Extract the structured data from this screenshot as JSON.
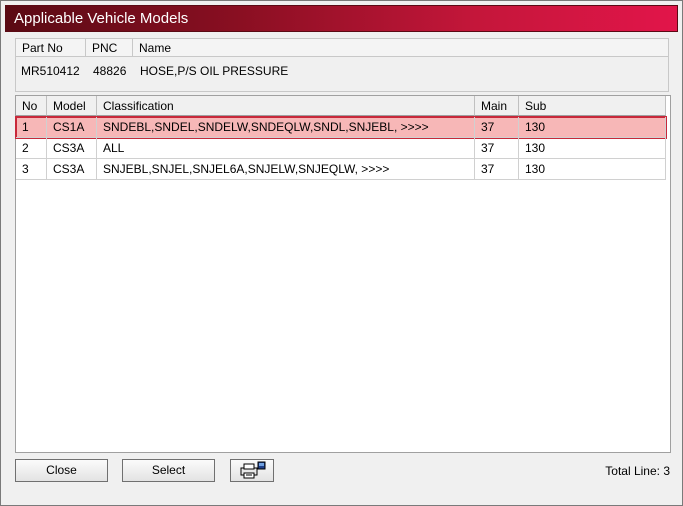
{
  "window": {
    "title": "Applicable Vehicle Models"
  },
  "part_info": {
    "headers": [
      "Part No",
      "PNC",
      "Name"
    ],
    "values": [
      "MR510412",
      "48826",
      "HOSE,P/S OIL PRESSURE"
    ]
  },
  "grid": {
    "columns": [
      "No",
      "Model",
      "Classification",
      "Main",
      "Sub"
    ],
    "rows": [
      {
        "no": "1",
        "model": "CS1A",
        "classification": "SNDEBL,SNDEL,SNDELW,SNDEQLW,SNDL,SNJEBL,  >>>>",
        "main": "37",
        "sub": "130",
        "selected": true
      },
      {
        "no": "2",
        "model": "CS3A",
        "classification": "ALL",
        "main": "37",
        "sub": "130",
        "selected": false
      },
      {
        "no": "3",
        "model": "CS3A",
        "classification": "SNJEBL,SNJEL,SNJEL6A,SNJELW,SNJEQLW,  >>>>",
        "main": "37",
        "sub": "130",
        "selected": false
      }
    ]
  },
  "buttons": {
    "close": "Close",
    "select": "Select",
    "print_icon": "printer-icon"
  },
  "footer": {
    "total_line": "Total Line: 3"
  }
}
